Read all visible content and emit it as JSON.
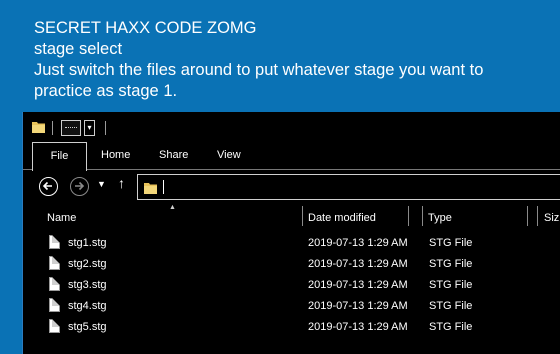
{
  "caption": {
    "line1": "SECRET HAXX CODE ZOMG",
    "line2": "stage select",
    "line3": "Just switch the files around to put whatever stage you want to",
    "line4": "practice as stage 1."
  },
  "ribbon": {
    "tabs": [
      "File",
      "Home",
      "Share",
      "View"
    ]
  },
  "address_bar": {
    "value": ""
  },
  "columns": {
    "name": "Name",
    "date_modified": "Date modified",
    "type": "Type",
    "size": "Siz"
  },
  "files": [
    {
      "name": "stg1.stg",
      "date": "2019-07-13 1:29 AM",
      "type": "STG File"
    },
    {
      "name": "stg2.stg",
      "date": "2019-07-13 1:29 AM",
      "type": "STG File"
    },
    {
      "name": "stg3.stg",
      "date": "2019-07-13 1:29 AM",
      "type": "STG File"
    },
    {
      "name": "stg4.stg",
      "date": "2019-07-13 1:29 AM",
      "type": "STG File"
    },
    {
      "name": "stg5.stg",
      "date": "2019-07-13 1:29 AM",
      "type": "STG File"
    }
  ],
  "icons": {
    "folder": "folder-icon",
    "properties": "properties-icon",
    "back": "back-arrow-icon",
    "forward": "forward-arrow-icon",
    "up": "up-arrow-icon",
    "file": "file-icon"
  },
  "colors": {
    "background": "#0a72b5",
    "window": "#000000",
    "folder": "#e8c25a"
  }
}
